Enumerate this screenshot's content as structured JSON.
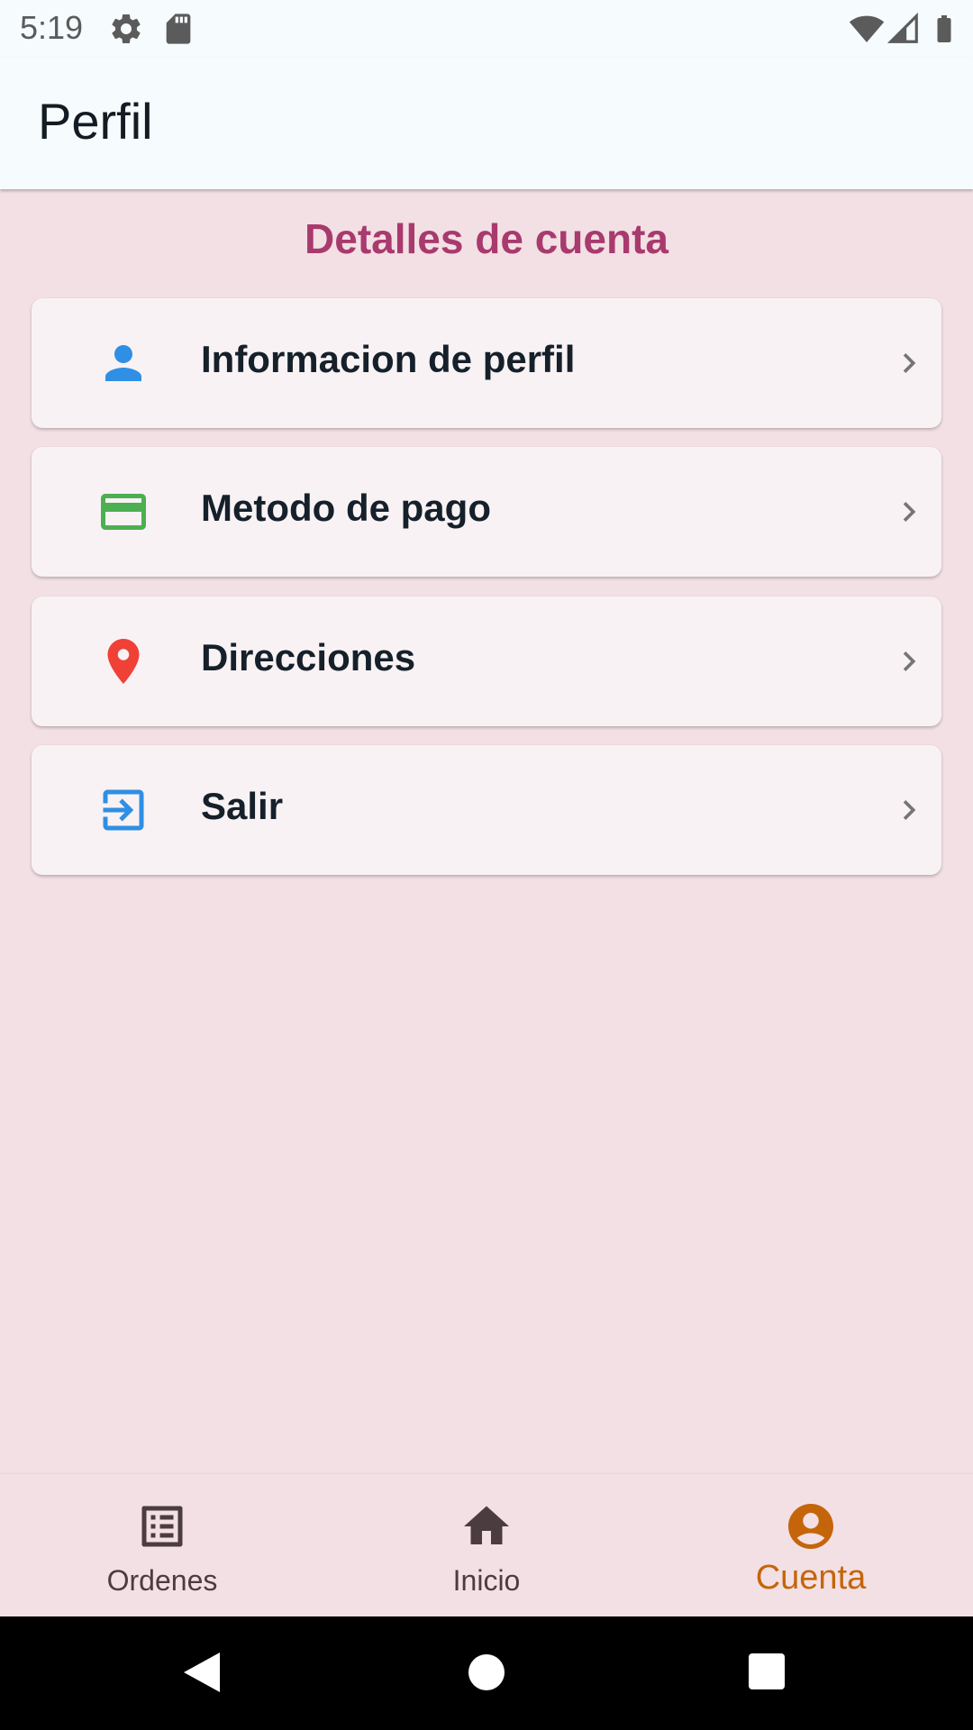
{
  "status_bar": {
    "time": "5:19"
  },
  "app_bar": {
    "title": "Perfil"
  },
  "section_title": "Detalles de cuenta",
  "menu": [
    {
      "label": "Informacion de perfil",
      "icon": "person-icon",
      "icon_color": "#2f8fe4"
    },
    {
      "label": "Metodo de pago",
      "icon": "credit-card-icon",
      "icon_color": "#4caf50"
    },
    {
      "label": "Direcciones",
      "icon": "location-pin-icon",
      "icon_color": "#ef4136"
    },
    {
      "label": "Salir",
      "icon": "logout-icon",
      "icon_color": "#2f8fe4"
    }
  ],
  "bottom_nav": {
    "items": [
      {
        "label": "Ordenes",
        "icon": "list-icon",
        "active": false
      },
      {
        "label": "Inicio",
        "icon": "home-icon",
        "active": false
      },
      {
        "label": "Cuenta",
        "icon": "account-circle-icon",
        "active": true
      }
    ],
    "active_color": "#c5650b",
    "inactive_color": "#4b3c40"
  },
  "colors": {
    "background": "#f3e0e4",
    "app_bar": "#f6fbfd",
    "section_title": "#a83a6e",
    "card": "#f8f2f4"
  }
}
